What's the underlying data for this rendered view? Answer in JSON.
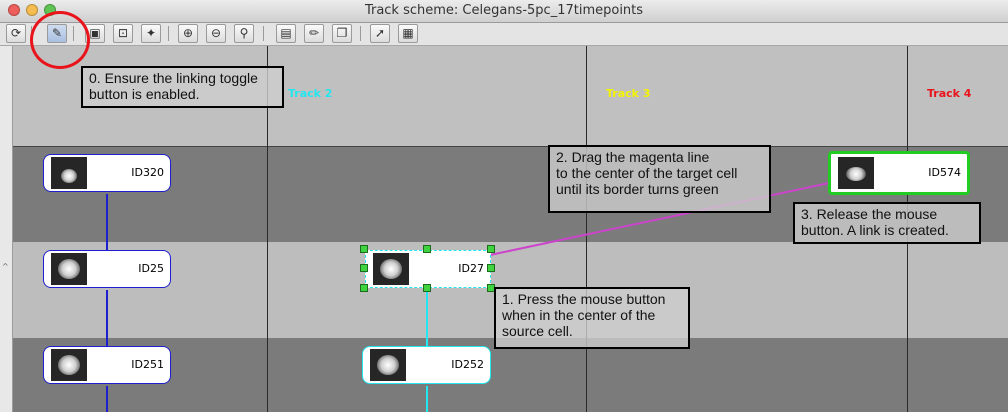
{
  "window": {
    "title": "Track scheme: Celegans-5pc_17timepoints"
  },
  "toolbar": {
    "buttons": [
      {
        "icon": "refresh-icon",
        "glyph": "⟳"
      },
      {
        "icon": "link-toggle-icon",
        "glyph": "✎"
      },
      {
        "icon": "style-icon",
        "glyph": "▣"
      },
      {
        "icon": "fit-icon",
        "glyph": "⊡"
      },
      {
        "icon": "select-icon",
        "glyph": "✦"
      },
      {
        "icon": "zoom-in-icon",
        "glyph": "⊕"
      },
      {
        "icon": "zoom-out-icon",
        "glyph": "⊖"
      },
      {
        "icon": "zoom-reset-icon",
        "glyph": "⚲"
      },
      {
        "icon": "save-icon",
        "glyph": "▤"
      },
      {
        "icon": "edit-icon",
        "glyph": "✏"
      },
      {
        "icon": "copy-icon",
        "glyph": "❐"
      },
      {
        "icon": "cursor-icon",
        "glyph": "➚"
      },
      {
        "icon": "table-icon",
        "glyph": "▦"
      }
    ]
  },
  "tracks": [
    {
      "label": "Track 2",
      "color": "#23e6f0"
    },
    {
      "label": "Track 3",
      "color": "#f3f300"
    },
    {
      "label": "Track 4",
      "color": "#e8131b"
    }
  ],
  "nodes": {
    "id320": "ID320",
    "id25": "ID25",
    "id251": "ID251",
    "id27": "ID27",
    "id252": "ID252",
    "id574": "ID574"
  },
  "annotations": {
    "step0": "0. Ensure the linking toggle\nbutton is enabled.",
    "step1": "1. Press the mouse button\nwhen in the center of the\nsource cell.",
    "step2": "2. Drag the magenta line\nto the center of the target cell\nuntil its border turns green",
    "step3": "3. Release the mouse\nbutton. A link is created."
  },
  "colors": {
    "track1_edge": "#1f1fd0",
    "track2_edge": "#23e6f0",
    "drag_line": "#cc44cc",
    "target_border": "#22cc22",
    "highlight": "#e8131b"
  }
}
